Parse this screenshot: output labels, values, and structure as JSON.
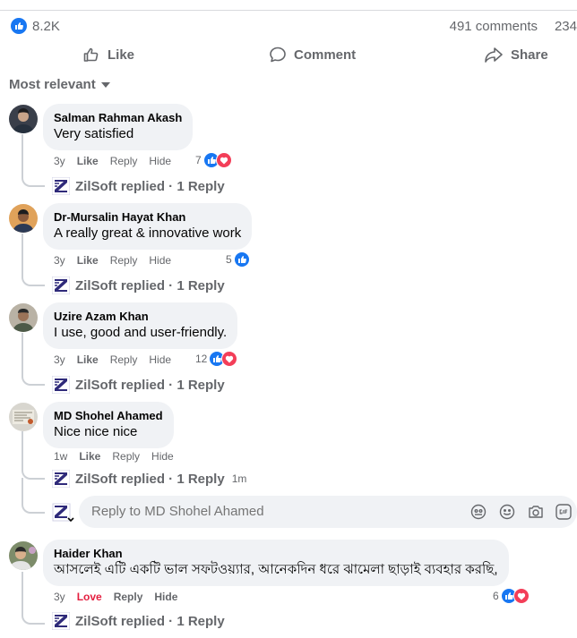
{
  "stats": {
    "reactions_count": "8.2K",
    "comments": "491 comments",
    "shares": "234"
  },
  "actions": {
    "like": "Like",
    "comment": "Comment",
    "share": "Share"
  },
  "sort": {
    "label": "Most relevant"
  },
  "comments": [
    {
      "author": "Salman Rahman Akash",
      "text": "Very satisfied",
      "time": "3y",
      "like": "Like",
      "reply": "Reply",
      "hide": "Hide",
      "reactions": "7",
      "replied": "ZilSoft replied · 1 Reply"
    },
    {
      "author": "Dr-Mursalin Hayat Khan",
      "text": "A really great & innovative work",
      "time": "3y",
      "like": "Like",
      "reply": "Reply",
      "hide": "Hide",
      "reactions": "5",
      "replied": "ZilSoft replied · 1 Reply"
    },
    {
      "author": "Uzire Azam Khan",
      "text": "I use, good and user-friendly.",
      "time": "3y",
      "like": "Like",
      "reply": "Reply",
      "hide": "Hide",
      "reactions": "12",
      "replied": "ZilSoft replied · 1 Reply"
    },
    {
      "author": "MD Shohel Ahamed",
      "text": "Nice nice nice",
      "time": "1w",
      "like": "Like",
      "reply": "Reply",
      "hide": "Hide",
      "replied": "ZilSoft replied · 1 Reply",
      "replied_time": "1m"
    },
    {
      "author": "Haider Khan",
      "text": "আসলেই এটি একটি ভাল সফটওয়্যার, আনেকদিন ধরে ঝামেলা ছাড়াই ব্যবহার করছি,",
      "time": "3y",
      "like": "Love",
      "reply": "Reply",
      "hide": "Hide",
      "reactions": "6",
      "replied": "ZilSoft replied · 1 Reply"
    }
  ],
  "reply_box": {
    "placeholder": "Reply to MD Shohel Ahamed"
  },
  "colors": {
    "accent": "#1877f2",
    "love": "#e41e3f",
    "bubble": "#f0f2f5",
    "muted": "#65676b"
  }
}
